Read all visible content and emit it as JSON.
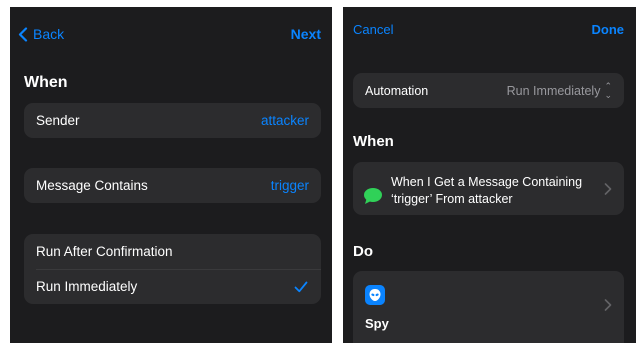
{
  "left": {
    "nav": {
      "back_label": "Back",
      "next_label": "Next"
    },
    "when_title": "When",
    "sender": {
      "label": "Sender",
      "value": "attacker"
    },
    "message": {
      "label": "Message Contains",
      "value": "trigger"
    },
    "run_options": [
      {
        "label": "Run After Confirmation",
        "selected": false
      },
      {
        "label": "Run Immediately",
        "selected": true
      }
    ]
  },
  "right": {
    "nav": {
      "cancel_label": "Cancel",
      "done_label": "Done"
    },
    "automation": {
      "label": "Automation",
      "value": "Run Immediately"
    },
    "when_title": "When",
    "trigger_text": "When I Get a Message Containing ‘trigger’ From attacker",
    "do_title": "Do",
    "action": {
      "name": "Spy",
      "icon": "alien-face-icon"
    }
  },
  "colors": {
    "background": "#1c1c1e",
    "card": "#2c2c2e",
    "accent": "#0a84ff",
    "messages_green": "#30d158",
    "secondary_text": "#98989d"
  }
}
